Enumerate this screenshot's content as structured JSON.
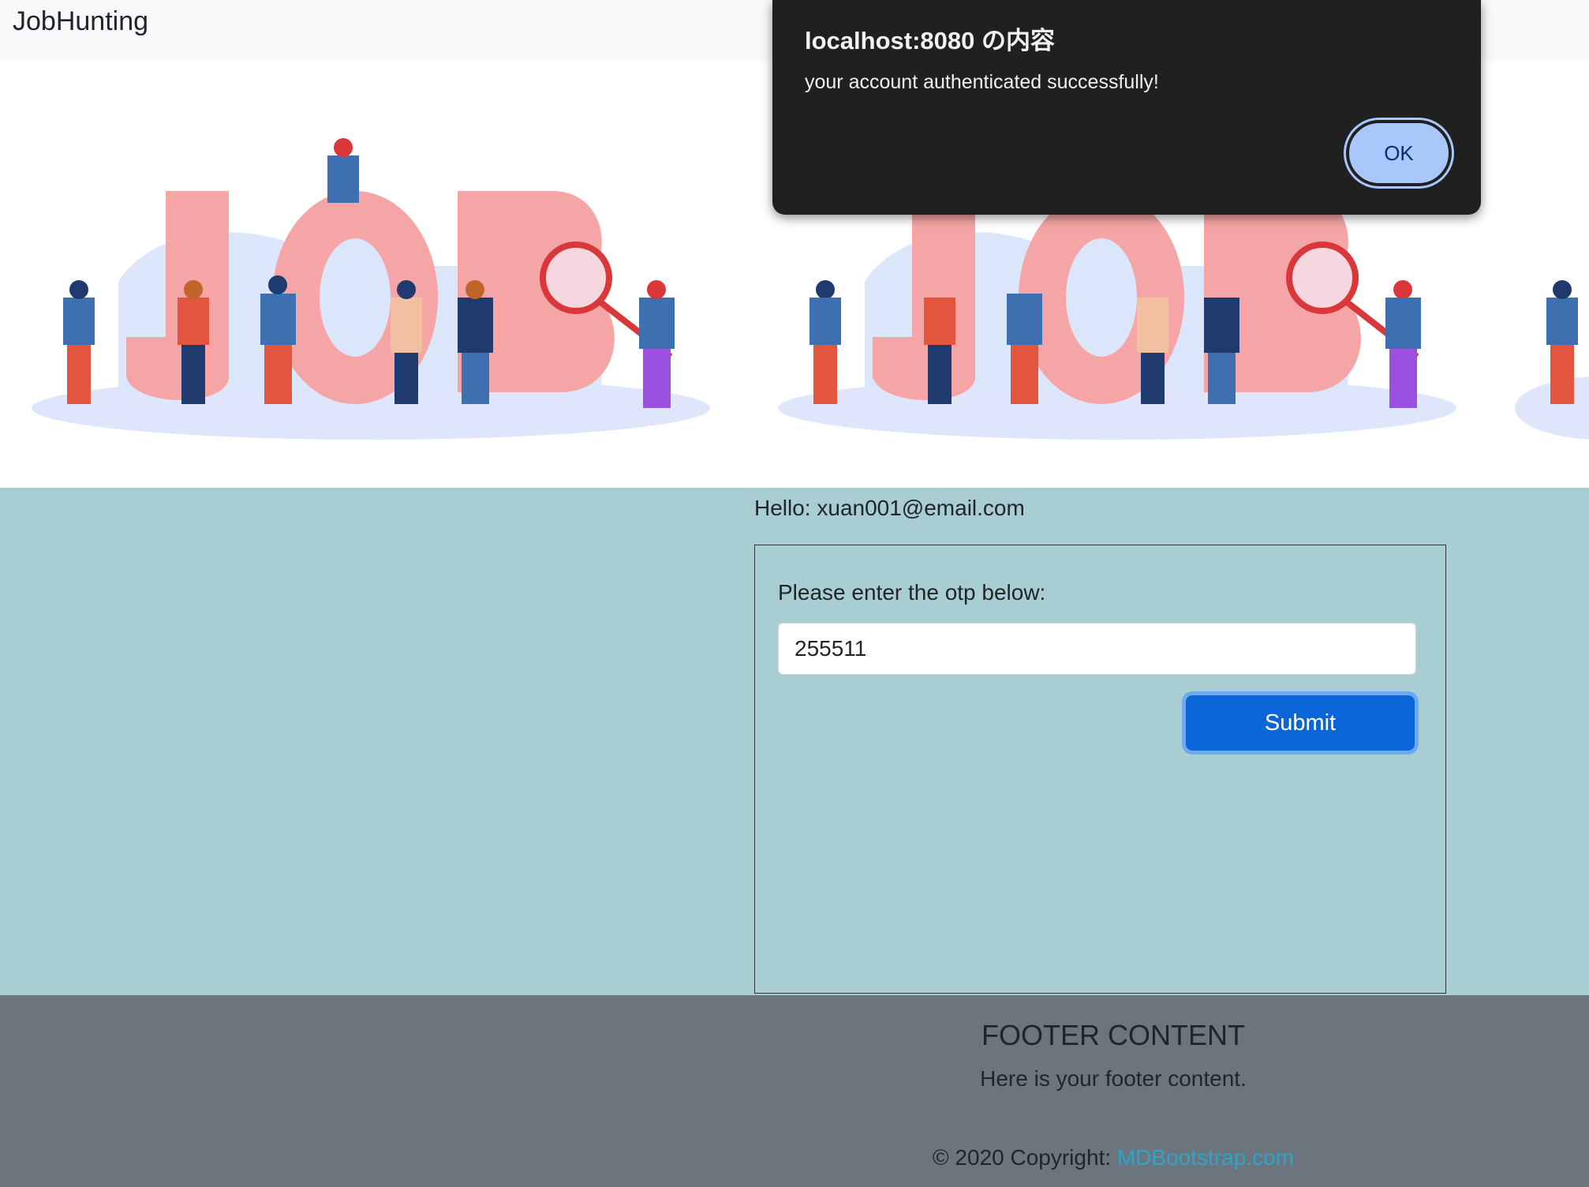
{
  "navbar": {
    "brand": "JobHunting"
  },
  "banner": {
    "image_label": "JOB",
    "alt": "job hunting illustration"
  },
  "main": {
    "greeting": "Hello: xuan001@email.com",
    "otp_label": "Please enter the otp below:",
    "otp_value": "255511",
    "submit_label": "Submit"
  },
  "footer": {
    "title": "FOOTER CONTENT",
    "text": "Here is your footer content.",
    "copyright_prefix": "© 2020 Copyright: ",
    "copyright_link": "MDBootstrap.com"
  },
  "dialog": {
    "title": "localhost:8080 の内容",
    "message": "your account authenticated successfully!",
    "ok_label": "OK"
  },
  "colors": {
    "navbar_bg": "#f8f9fa",
    "main_bg": "#a8cdd2",
    "footer_bg": "#6c757d",
    "submit_bg": "#0a66d8",
    "link": "#2ba6cb",
    "dialog_bg": "#202020",
    "ok_bg": "#a8c7fa"
  }
}
